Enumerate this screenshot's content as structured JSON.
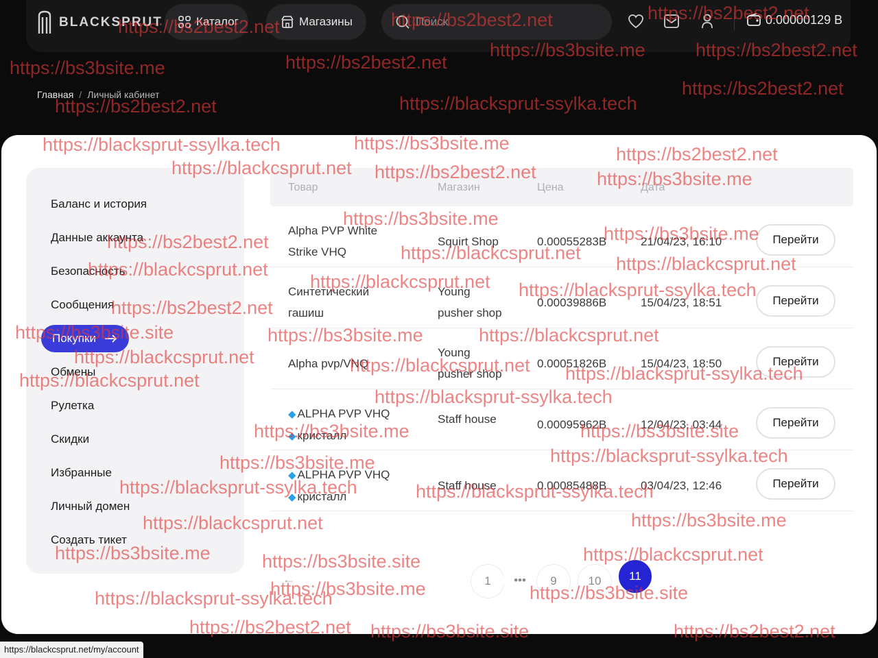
{
  "header": {
    "logo_text": "BLACKSPRUT",
    "catalog_label": "Каталог",
    "shops_label": "Магазины",
    "search_placeholder": "Поиск",
    "balance": "0.00000129 B"
  },
  "breadcrumb": {
    "home": "Главная",
    "separator": "/",
    "current": "Личный кабинет"
  },
  "sidebar": {
    "items": [
      {
        "label": "Баланс и история"
      },
      {
        "label": "Данные аккаунта"
      },
      {
        "label": "Безопасность"
      },
      {
        "label": "Сообщения"
      },
      {
        "label": "Покупки",
        "active": true
      },
      {
        "label": "Обмены"
      },
      {
        "label": "Рулетка"
      },
      {
        "label": "Скидки"
      },
      {
        "label": "Избранные"
      },
      {
        "label": "Личный домен"
      },
      {
        "label": "Создать тикет"
      }
    ]
  },
  "table": {
    "headers": {
      "product": "Товар",
      "shop": "Магазин",
      "price": "Цена",
      "date": "Дата"
    },
    "button_label": "Перейти",
    "rows": [
      {
        "product_l1": "Alpha PVP White",
        "product_l2": "Strike VHQ",
        "shop_l1": "Squirt Shop",
        "shop_l2": "",
        "price": "0.00055283B",
        "date": "21/04/23, 16:10"
      },
      {
        "product_l1": "Синтетический",
        "product_l2": "гашиш",
        "shop_l1": "Young",
        "shop_l2": "pusher shop",
        "price": "0.00039886B",
        "date": "15/04/23, 18:51"
      },
      {
        "product_l1": "Alpha pvp/VNQ",
        "product_l2": "",
        "shop_l1": "Young",
        "shop_l2": "pusher shop",
        "price": "0.00051826B",
        "date": "15/04/23, 18:50"
      },
      {
        "product_l1": "ALPHA PVP VHQ",
        "product_l2": "кристалл",
        "shop_l1": "Staff house",
        "shop_l2": "",
        "price": "0.00095962B",
        "date": "12/04/23, 03:44",
        "gem": true
      },
      {
        "product_l1": "ALPHA PVP VHQ",
        "product_l2": "кристалл",
        "shop_l1": "Staff house",
        "shop_l2": "",
        "price": "0.00085488B",
        "date": "03/04/23, 12:46",
        "gem": true
      }
    ]
  },
  "pagination": {
    "pages": [
      "1",
      "•••",
      "9",
      "10",
      "11"
    ],
    "active": "11"
  },
  "status_url": "https://blackcsprut.net/my/account",
  "watermarks": [
    "https://bs2best2.net",
    "https://bs3bsite.me",
    "https://blacksprut-ssylka.tech",
    "https://blackcsprut.net",
    "https://bs3bsite.site"
  ],
  "colors": {
    "accent": "#2424d4",
    "active_item": "#3b3bd9",
    "watermark": "#e23838",
    "dark_bg": "#0b0b0c"
  }
}
